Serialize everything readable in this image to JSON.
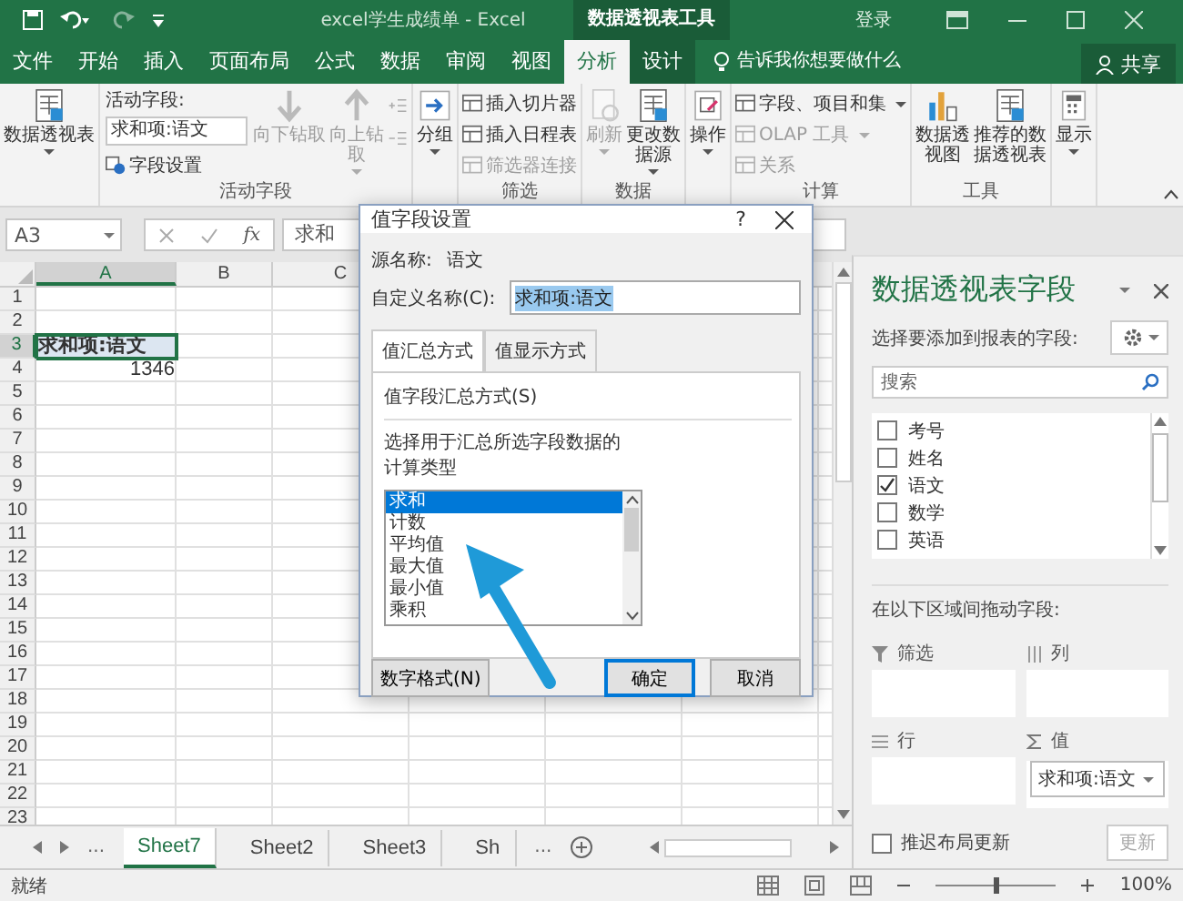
{
  "title_bar": {
    "title": "excel学生成绩单 - Excel",
    "context_label": "数据透视表工具",
    "sign_in": "登录"
  },
  "ribbon_tabs": [
    {
      "label": "文件",
      "selected": false,
      "contextual": false
    },
    {
      "label": "开始",
      "selected": false,
      "contextual": false
    },
    {
      "label": "插入",
      "selected": false,
      "contextual": false
    },
    {
      "label": "页面布局",
      "selected": false,
      "contextual": false
    },
    {
      "label": "公式",
      "selected": false,
      "contextual": false
    },
    {
      "label": "数据",
      "selected": false,
      "contextual": false
    },
    {
      "label": "审阅",
      "selected": false,
      "contextual": false
    },
    {
      "label": "视图",
      "selected": false,
      "contextual": false
    },
    {
      "label": "分析",
      "selected": true,
      "contextual": true
    },
    {
      "label": "设计",
      "selected": false,
      "contextual": true
    }
  ],
  "tell_me": "告诉我你想要做什么",
  "share": "共享",
  "ribbon_groups": [
    {
      "items": [
        {
          "kind": "large",
          "label": "数据透视表",
          "dropdown": true,
          "disabled": false
        }
      ]
    },
    {
      "label": "活动字段",
      "items": [
        {
          "kind": "field",
          "caption": "活动字段:",
          "value": "求和项:语文",
          "setting": "字段设置"
        },
        {
          "kind": "large",
          "label": "向下钻取",
          "dropdown": false,
          "disabled": true
        },
        {
          "kind": "large",
          "label": "向上钻取",
          "dropdown": true,
          "disabled": true
        },
        {
          "kind": "icons",
          "disabled": true
        }
      ]
    },
    {
      "items": [
        {
          "kind": "large",
          "label": "分组",
          "dropdown": true,
          "disabled": false
        }
      ]
    },
    {
      "label": "筛选",
      "items": [
        {
          "kind": "stack",
          "entries": [
            {
              "label": "插入切片器",
              "disabled": false,
              "dropdown": false
            },
            {
              "label": "插入日程表",
              "disabled": false,
              "dropdown": false
            },
            {
              "label": "筛选器连接",
              "disabled": true,
              "dropdown": false
            }
          ]
        }
      ]
    },
    {
      "label": "数据",
      "items": [
        {
          "kind": "large",
          "label": "刷新",
          "dropdown": true,
          "disabled": true
        },
        {
          "kind": "large",
          "label": "更改数据源",
          "dropdown": true,
          "disabled": false
        }
      ]
    },
    {
      "items": [
        {
          "kind": "large",
          "label": "操作",
          "dropdown": true,
          "disabled": false
        }
      ]
    },
    {
      "label": "计算",
      "items": [
        {
          "kind": "stack",
          "entries": [
            {
              "label": "字段、项目和集",
              "disabled": false,
              "dropdown": true
            },
            {
              "label": "OLAP 工具",
              "disabled": true,
              "dropdown": true
            },
            {
              "label": "关系",
              "disabled": true,
              "dropdown": false
            }
          ]
        }
      ]
    },
    {
      "label": "工具",
      "items": [
        {
          "kind": "large",
          "label": "数据透视图",
          "dropdown": false,
          "disabled": false
        },
        {
          "kind": "large",
          "label": "推荐的数据透视表",
          "dropdown": false,
          "disabled": false
        }
      ]
    },
    {
      "items": [
        {
          "kind": "large",
          "label": "显示",
          "dropdown": true,
          "disabled": false
        }
      ]
    }
  ],
  "formula_bar": {
    "name_box": "A3",
    "function_button": "fx",
    "formula": "求和"
  },
  "sheet": {
    "columns": [
      "A",
      "B",
      "C"
    ],
    "rows": [
      {
        "label": "1"
      },
      {
        "label": "2"
      },
      {
        "label": "3",
        "cell_a": {
          "text": "求和项:语文",
          "bold": true,
          "kind": "label",
          "selected": true
        }
      },
      {
        "label": "4",
        "cell_a": {
          "text": "1346",
          "bold": false,
          "kind": "number",
          "selected": false
        }
      },
      {
        "label": "5"
      },
      {
        "label": "6"
      },
      {
        "label": "7"
      },
      {
        "label": "8"
      },
      {
        "label": "9"
      },
      {
        "label": "10"
      },
      {
        "label": "11"
      },
      {
        "label": "12"
      },
      {
        "label": "13"
      },
      {
        "label": "14"
      },
      {
        "label": "15"
      },
      {
        "label": "16"
      },
      {
        "label": "17"
      },
      {
        "label": "18"
      },
      {
        "label": "19"
      },
      {
        "label": "20"
      },
      {
        "label": "21"
      },
      {
        "label": "22"
      },
      {
        "label": "23"
      }
    ]
  },
  "sheet_tabs": {
    "more_left": "...",
    "tabs": [
      {
        "label": "Sheet7",
        "selected": true
      },
      {
        "label": "Sheet2",
        "selected": false
      },
      {
        "label": "Sheet3",
        "selected": false
      },
      {
        "label": "Sh",
        "selected": false
      }
    ],
    "more_right": "..."
  },
  "status_bar": {
    "status": "就绪",
    "zoom": "100%",
    "zoom_level": {
      "level": 0.5
    }
  },
  "dialog": {
    "title": "值字段设置",
    "help": "?",
    "source_label": "源名称:",
    "source_value": "语文",
    "custom_name_label": "自定义名称(C):",
    "custom_name_value": "求和项:语文",
    "tabs": [
      {
        "label": "值汇总方式",
        "selected": true
      },
      {
        "label": "值显示方式",
        "selected": false
      }
    ],
    "section_title": "值字段汇总方式(S)",
    "description": "选择用于汇总所选字段数据的计算类型",
    "options": [
      {
        "label": "求和",
        "selected": true
      },
      {
        "label": "计数",
        "selected": false
      },
      {
        "label": "平均值",
        "selected": false
      },
      {
        "label": "最大值",
        "selected": false
      },
      {
        "label": "最小值",
        "selected": false
      },
      {
        "label": "乘积",
        "selected": false
      }
    ],
    "buttons": [
      {
        "label": "数字格式(N)",
        "default": false
      },
      {
        "label": "确定",
        "default": true
      },
      {
        "label": "取消",
        "default": false
      }
    ]
  },
  "field_pane": {
    "title": "数据透视表字段",
    "choose_label": "选择要添加到报表的字段:",
    "search": {
      "placeholder": "搜索"
    },
    "fields": [
      {
        "label": "考号",
        "checked": false
      },
      {
        "label": "姓名",
        "checked": false
      },
      {
        "label": "语文",
        "checked": true
      },
      {
        "label": "数学",
        "checked": false
      },
      {
        "label": "英语",
        "checked": false
      }
    ],
    "drag_label": "在以下区域间拖动字段:",
    "areas": [
      {
        "kind": "filter",
        "label": "筛选"
      },
      {
        "kind": "columns",
        "label": "列"
      },
      {
        "kind": "rows",
        "label": "行"
      },
      {
        "kind": "values",
        "label": "值",
        "chips": [
          "求和项:语文"
        ]
      }
    ],
    "defer_update": {
      "label": "推迟布局更新",
      "checked": false
    },
    "update_button": {
      "label": "更新",
      "disabled": true
    }
  }
}
